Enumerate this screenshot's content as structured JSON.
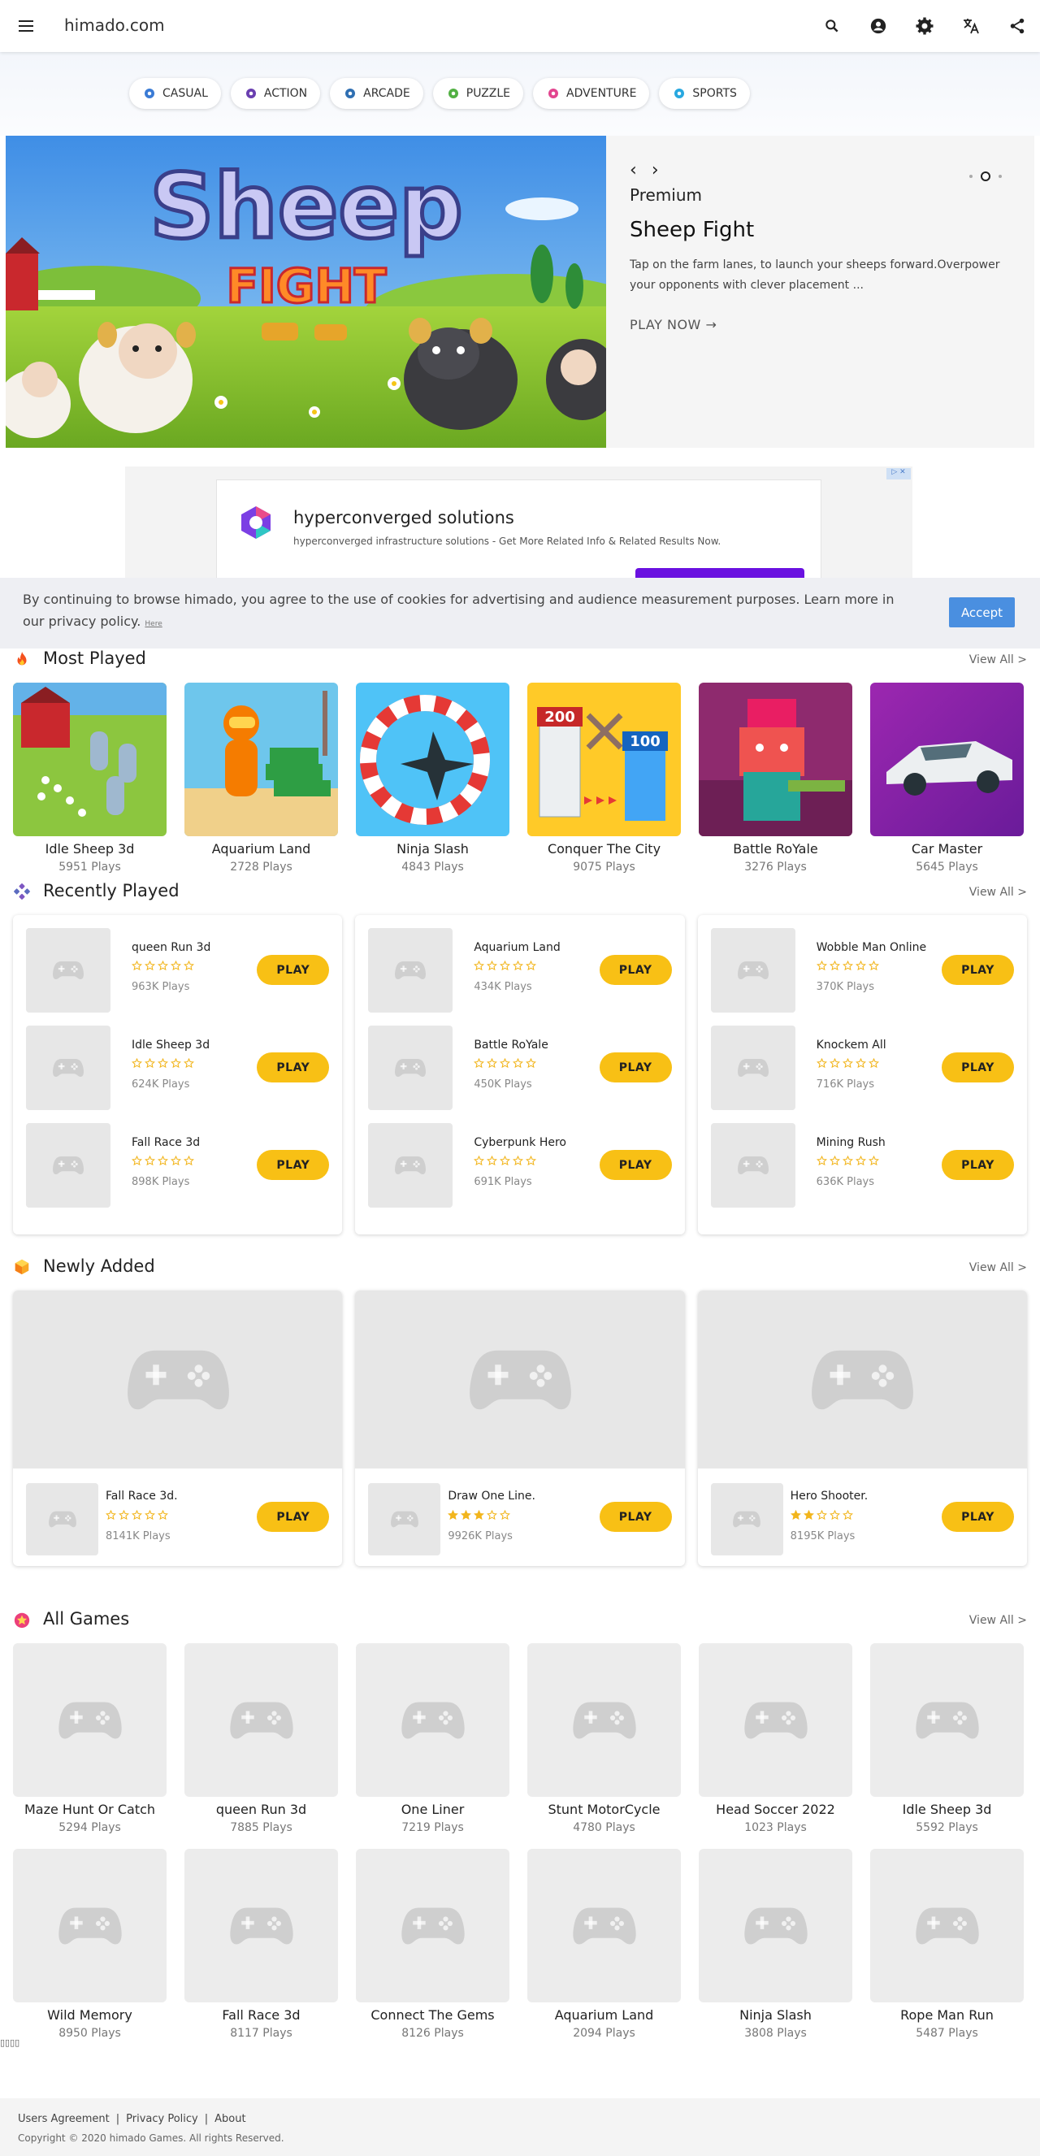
{
  "topbar": {
    "title": "himado.com"
  },
  "categories": [
    {
      "label": "CASUAL",
      "color": "#3a7bd5"
    },
    {
      "label": "ACTION",
      "color": "#6a3fb0"
    },
    {
      "label": "ARCADE",
      "color": "#2f6fb2"
    },
    {
      "label": "PUZZLE",
      "color": "#52b043"
    },
    {
      "label": "ADVENTURE",
      "color": "#e2458f"
    },
    {
      "label": "SPORTS",
      "color": "#28a8e0"
    }
  ],
  "banner": {
    "logo_line1": "Sheep",
    "logo_line2": "FIGHT",
    "premium": "Premium",
    "title": "Sheep Fight",
    "description": "Tap on the farm lanes, to launch your sheeps forward.Overpower your opponents with clever placement ...",
    "play_now": "PLAY NOW"
  },
  "ad": {
    "title": "hyperconverged solutions",
    "description": "hyperconverged infrastructure solutions - Get More Related Info & Related Results Now."
  },
  "cookie": {
    "text": "By continuing to browse himado, you agree to the use of cookies for advertising and audience measurement purposes. Learn more in our privacy policy.",
    "link": "Here",
    "accept": "Accept"
  },
  "most_played": {
    "title": "Most Played",
    "view_all": "View All >",
    "games": [
      {
        "name": "Idle Sheep 3d",
        "plays": "5951 Plays"
      },
      {
        "name": "Aquarium Land",
        "plays": "2728 Plays"
      },
      {
        "name": "Ninja Slash",
        "plays": "4843 Plays"
      },
      {
        "name": "Conquer The City",
        "plays": "9075 Plays"
      },
      {
        "name": "Battle RoYale",
        "plays": "3276 Plays"
      },
      {
        "name": "Car Master",
        "plays": "5645 Plays"
      }
    ]
  },
  "conquer": {
    "left_num": "200",
    "right_num": "100"
  },
  "recently_played": {
    "title": "Recently Played",
    "view_all": "View All >",
    "play_label": "PLAY",
    "columns": [
      [
        {
          "name": "queen Run 3d",
          "plays": "963K Plays"
        },
        {
          "name": "Idle Sheep 3d",
          "plays": "624K Plays"
        },
        {
          "name": "Fall Race 3d",
          "plays": "898K Plays"
        }
      ],
      [
        {
          "name": "Aquarium Land",
          "plays": "434K Plays"
        },
        {
          "name": "Battle RoYale",
          "plays": "450K Plays"
        },
        {
          "name": "Cyberpunk Hero",
          "plays": "691K Plays"
        }
      ],
      [
        {
          "name": "Wobble Man Online",
          "plays": "370K Plays"
        },
        {
          "name": "Knockem All",
          "plays": "716K Plays"
        },
        {
          "name": "Mining Rush",
          "plays": "636K Plays"
        }
      ]
    ]
  },
  "newly_added": {
    "title": "Newly Added",
    "view_all": "View All >",
    "play_label": "PLAY",
    "games": [
      {
        "name": "Fall Race 3d.",
        "plays": "8141K Plays",
        "rating": 0
      },
      {
        "name": "Draw One Line.",
        "plays": "9926K Plays",
        "rating": 3
      },
      {
        "name": "Hero Shooter.",
        "plays": "8195K Plays",
        "rating": 2
      }
    ]
  },
  "all_games": {
    "title": "All Games",
    "view_all": "View All >",
    "games": [
      {
        "name": "Maze Hunt Or Catch",
        "plays": "5294 Plays"
      },
      {
        "name": "queen Run 3d",
        "plays": "7885 Plays"
      },
      {
        "name": "One Liner",
        "plays": "7219 Plays"
      },
      {
        "name": "Stunt MotorCycle",
        "plays": "4780 Plays"
      },
      {
        "name": "Head Soccer 2022",
        "plays": "1023 Plays"
      },
      {
        "name": "Idle Sheep 3d",
        "plays": "5592 Plays"
      },
      {
        "name": "Wild Memory",
        "plays": "8950 Plays"
      },
      {
        "name": "Fall Race 3d",
        "plays": "8117 Plays"
      },
      {
        "name": "Connect The Gems",
        "plays": "8126 Plays"
      },
      {
        "name": "Aquarium Land",
        "plays": "2094 Plays"
      },
      {
        "name": "Ninja Slash",
        "plays": "3808 Plays"
      },
      {
        "name": "Rope Man Run",
        "plays": "5487 Plays"
      }
    ]
  },
  "junk_glyphs": "▯▯▯▯",
  "footer": {
    "links": [
      "Users Agreement",
      "Privacy Policy",
      "About"
    ],
    "separator": "|",
    "copyright": "Copyright © 2020 himado Games. All rights Reserved."
  },
  "colors": {
    "accent_yellow": "#f8c015",
    "star": "#f2b51c",
    "accept_blue": "#4a8fe0",
    "ad_button": "#6a11e0"
  }
}
